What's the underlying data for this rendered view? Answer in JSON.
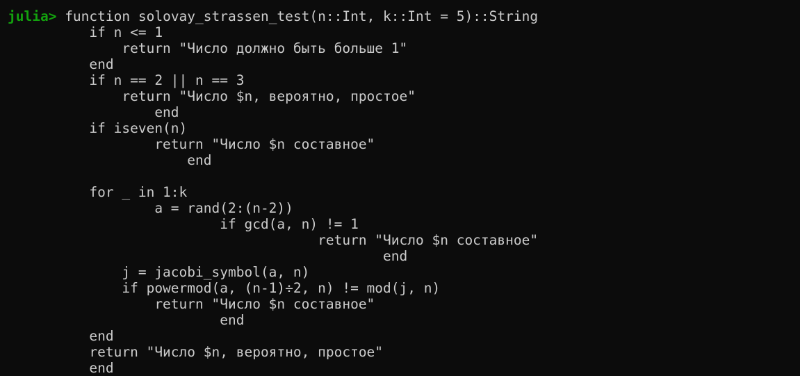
{
  "terminal": {
    "prompt": "julia>",
    "first_line": " function solovay_strassen_test(n::Int, k::Int = 5)::String",
    "lines": [
      "          if n <= 1",
      "              return \"Число должно быть больше 1\"",
      "          end",
      "          if n == 2 || n == 3",
      "              return \"Число $n, вероятно, простое\"",
      "                  end",
      "          if iseven(n)",
      "                  return \"Число $n составное\"",
      "                      end",
      "",
      "          for _ in 1:k",
      "                  a = rand(2:(n-2))",
      "                          if gcd(a, n) != 1",
      "                                      return \"Число $n составное\"",
      "                                              end",
      "              j = jacobi_symbol(a, n)",
      "              if powermod(a, (n-1)÷2, n) != mod(j, n)",
      "                  return \"Число $n составное\"",
      "                          end",
      "          end",
      "          return \"Число $n, вероятно, простое\"",
      "          end"
    ]
  }
}
